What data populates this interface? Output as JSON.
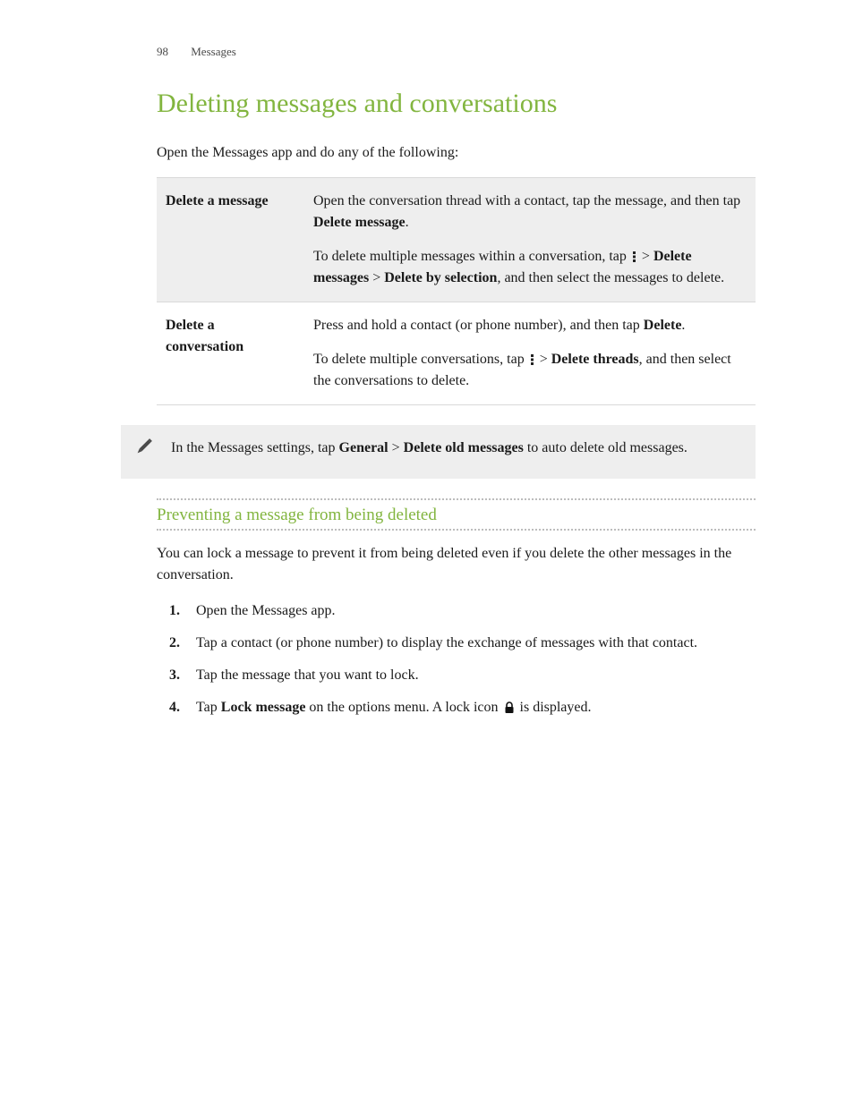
{
  "header": {
    "page_number": "98",
    "section": "Messages"
  },
  "title": "Deleting messages and conversations",
  "intro": "Open the Messages app and do any of the following:",
  "table": {
    "row1": {
      "label": "Delete a message",
      "p1_a": "Open the conversation thread with a contact, tap the message, and then tap ",
      "p1_b": "Delete message",
      "p1_c": ".",
      "p2_a": "To delete multiple messages within a conversation, tap ",
      "p2_b": " > ",
      "p2_c": "Delete messages",
      "p2_d": " > ",
      "p2_e": "Delete by selection",
      "p2_f": ", and then select the messages to delete."
    },
    "row2": {
      "label": "Delete a conversation",
      "p1_a": "Press and hold a contact (or phone number), and then tap ",
      "p1_b": "Delete",
      "p1_c": ".",
      "p2_a": "To delete multiple conversations, tap ",
      "p2_b": " > ",
      "p2_c": "Delete threads",
      "p2_d": ", and then select the conversations to delete."
    }
  },
  "tip": {
    "a": "In the Messages settings, tap ",
    "b": "General",
    "c": " > ",
    "d": "Delete old messages",
    "e": " to auto delete old messages."
  },
  "subheading": "Preventing a message from being deleted",
  "sub_intro": "You can lock a message to prevent it from being deleted even if you delete the other messages in the conversation.",
  "steps": {
    "s1": "Open the Messages app.",
    "s2": "Tap a contact (or phone number) to display the exchange of messages with that contact.",
    "s3": "Tap the message that you want to lock.",
    "s4_a": "Tap ",
    "s4_b": "Lock message",
    "s4_c": " on the options menu. A lock icon ",
    "s4_d": " is displayed."
  }
}
